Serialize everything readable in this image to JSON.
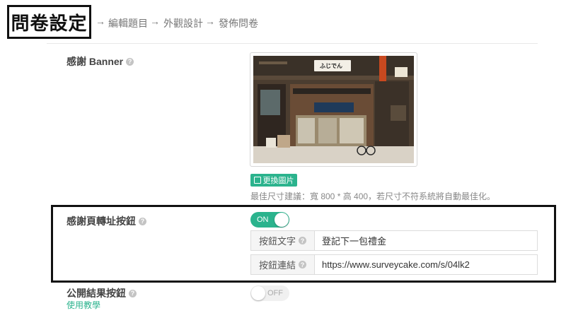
{
  "breadcrumb": {
    "steps": [
      "問卷設定",
      "編輯題目",
      "外觀設計",
      "發佈問卷"
    ],
    "separator": "→"
  },
  "banner_section": {
    "label": "感謝 Banner",
    "help_icon": "help-icon",
    "image_subject": "Japanese storefront street scene with shop sign ふじでん",
    "shop_sign": "ふじでん",
    "change_button": "更換圖片",
    "change_icon": "image-icon",
    "size_hint": "最佳尺寸建議：寬 800 * 高 400，若尺寸不符系統將自動最佳化。"
  },
  "redirect_button": {
    "label": "感謝頁轉址按鈕",
    "toggle_state": "ON",
    "text_label": "按鈕文字",
    "text_value": "登記下一包禮金",
    "link_label": "按鈕連結",
    "link_value": "https://www.surveycake.com/s/04lk2"
  },
  "public_results": {
    "label": "公開結果按鈕",
    "toggle_state": "OFF",
    "tutorial_link": "使用教學"
  },
  "colors": {
    "accent": "#2bb38d",
    "highlight_border": "#111111"
  }
}
